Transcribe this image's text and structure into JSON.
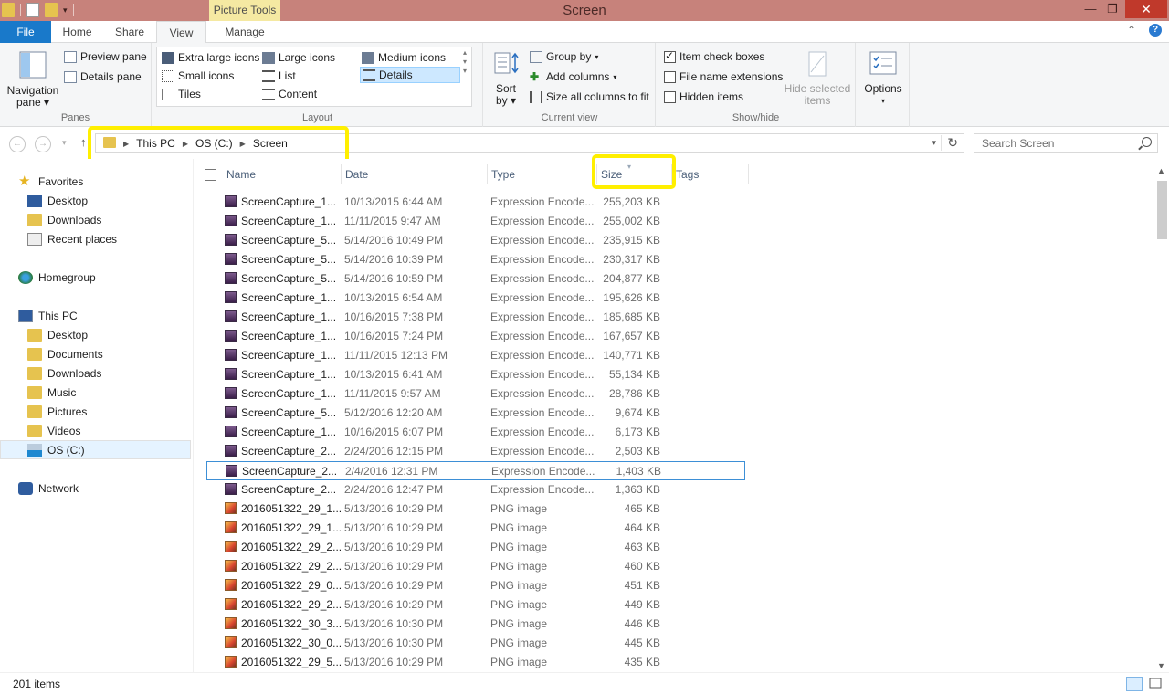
{
  "window": {
    "title": "Screen",
    "contextual_tab": "Picture Tools"
  },
  "tabs": [
    "File",
    "Home",
    "Share",
    "View",
    "Manage"
  ],
  "ribbon": {
    "panes": {
      "navigation_pane": "Navigation",
      "navigation_pane_line2": "pane",
      "preview_pane": "Preview pane",
      "details_pane": "Details pane",
      "label": "Panes"
    },
    "layout": {
      "extra_large_icons": "Extra large icons",
      "large_icons": "Large icons",
      "medium_icons": "Medium icons",
      "small_icons": "Small icons",
      "list": "List",
      "details": "Details",
      "tiles": "Tiles",
      "content": "Content",
      "label": "Layout"
    },
    "current_view": {
      "sort_by": "Sort",
      "sort_by_line2": "by",
      "group_by": "Group by",
      "add_columns": "Add columns",
      "size_all_columns": "Size all columns to fit",
      "label": "Current view"
    },
    "show_hide": {
      "item_check_boxes": "Item check boxes",
      "item_check_boxes_checked": true,
      "file_name_extensions": "File name extensions",
      "file_name_extensions_checked": false,
      "hidden_items": "Hidden items",
      "hidden_items_checked": false,
      "hide_selected_items": "Hide selected",
      "hide_selected_items_line2": "items",
      "label": "Show/hide"
    },
    "options": "Options"
  },
  "address": {
    "crumbs": [
      "This PC",
      "OS (C:)",
      "Screen"
    ],
    "search_placeholder": "Search Screen"
  },
  "nav": {
    "favorites": "Favorites",
    "favorites_items": [
      "Desktop",
      "Downloads",
      "Recent places"
    ],
    "homegroup": "Homegroup",
    "this_pc": "This PC",
    "this_pc_items": [
      "Desktop",
      "Documents",
      "Downloads",
      "Music",
      "Pictures",
      "Videos",
      "OS (C:)"
    ],
    "network": "Network"
  },
  "columns": [
    "Name",
    "Date",
    "Type",
    "Size",
    "Tags"
  ],
  "files": [
    {
      "name": "ScreenCapture_1...",
      "date": "10/13/2015 6:44 AM",
      "type": "Expression Encode...",
      "size": "255,203 KB",
      "kind": "video"
    },
    {
      "name": "ScreenCapture_1...",
      "date": "11/11/2015 9:47 AM",
      "type": "Expression Encode...",
      "size": "255,002 KB",
      "kind": "video"
    },
    {
      "name": "ScreenCapture_5...",
      "date": "5/14/2016 10:49 PM",
      "type": "Expression Encode...",
      "size": "235,915 KB",
      "kind": "video"
    },
    {
      "name": "ScreenCapture_5...",
      "date": "5/14/2016 10:39 PM",
      "type": "Expression Encode...",
      "size": "230,317 KB",
      "kind": "video"
    },
    {
      "name": "ScreenCapture_5...",
      "date": "5/14/2016 10:59 PM",
      "type": "Expression Encode...",
      "size": "204,877 KB",
      "kind": "video"
    },
    {
      "name": "ScreenCapture_1...",
      "date": "10/13/2015 6:54 AM",
      "type": "Expression Encode...",
      "size": "195,626 KB",
      "kind": "video"
    },
    {
      "name": "ScreenCapture_1...",
      "date": "10/16/2015 7:38 PM",
      "type": "Expression Encode...",
      "size": "185,685 KB",
      "kind": "video"
    },
    {
      "name": "ScreenCapture_1...",
      "date": "10/16/2015 7:24 PM",
      "type": "Expression Encode...",
      "size": "167,657 KB",
      "kind": "video"
    },
    {
      "name": "ScreenCapture_1...",
      "date": "11/11/2015 12:13 PM",
      "type": "Expression Encode...",
      "size": "140,771 KB",
      "kind": "video"
    },
    {
      "name": "ScreenCapture_1...",
      "date": "10/13/2015 6:41 AM",
      "type": "Expression Encode...",
      "size": "55,134 KB",
      "kind": "video"
    },
    {
      "name": "ScreenCapture_1...",
      "date": "11/11/2015 9:57 AM",
      "type": "Expression Encode...",
      "size": "28,786 KB",
      "kind": "video"
    },
    {
      "name": "ScreenCapture_5...",
      "date": "5/12/2016 12:20 AM",
      "type": "Expression Encode...",
      "size": "9,674 KB",
      "kind": "video"
    },
    {
      "name": "ScreenCapture_1...",
      "date": "10/16/2015 6:07 PM",
      "type": "Expression Encode...",
      "size": "6,173 KB",
      "kind": "video"
    },
    {
      "name": "ScreenCapture_2...",
      "date": "2/24/2016 12:15 PM",
      "type": "Expression Encode...",
      "size": "2,503 KB",
      "kind": "video"
    },
    {
      "name": "ScreenCapture_2...",
      "date": "2/4/2016 12:31 PM",
      "type": "Expression Encode...",
      "size": "1,403 KB",
      "kind": "video"
    },
    {
      "name": "ScreenCapture_2...",
      "date": "2/24/2016 12:47 PM",
      "type": "Expression Encode...",
      "size": "1,363 KB",
      "kind": "video"
    },
    {
      "name": "2016051322_29_1...",
      "date": "5/13/2016 10:29 PM",
      "type": "PNG image",
      "size": "465 KB",
      "kind": "png"
    },
    {
      "name": "2016051322_29_1...",
      "date": "5/13/2016 10:29 PM",
      "type": "PNG image",
      "size": "464 KB",
      "kind": "png"
    },
    {
      "name": "2016051322_29_2...",
      "date": "5/13/2016 10:29 PM",
      "type": "PNG image",
      "size": "463 KB",
      "kind": "png"
    },
    {
      "name": "2016051322_29_2...",
      "date": "5/13/2016 10:29 PM",
      "type": "PNG image",
      "size": "460 KB",
      "kind": "png"
    },
    {
      "name": "2016051322_29_0...",
      "date": "5/13/2016 10:29 PM",
      "type": "PNG image",
      "size": "451 KB",
      "kind": "png"
    },
    {
      "name": "2016051322_29_2...",
      "date": "5/13/2016 10:29 PM",
      "type": "PNG image",
      "size": "449 KB",
      "kind": "png"
    },
    {
      "name": "2016051322_30_3...",
      "date": "5/13/2016 10:30 PM",
      "type": "PNG image",
      "size": "446 KB",
      "kind": "png"
    },
    {
      "name": "2016051322_30_0...",
      "date": "5/13/2016 10:30 PM",
      "type": "PNG image",
      "size": "445 KB",
      "kind": "png"
    },
    {
      "name": "2016051322_29_5...",
      "date": "5/13/2016 10:29 PM",
      "type": "PNG image",
      "size": "435 KB",
      "kind": "png"
    }
  ],
  "focused_row": 14,
  "status": {
    "item_count": "201 items"
  },
  "colors": {
    "titlebar": "#c7827b",
    "file_tab": "#1979ca",
    "picture_tools": "#f5e9a2",
    "highlight": "#ffef00"
  }
}
